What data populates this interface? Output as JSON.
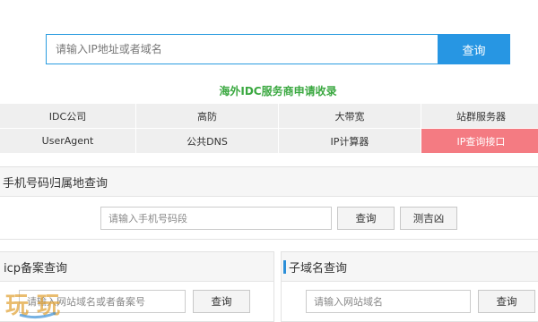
{
  "search": {
    "placeholder": "请输入IP地址或者域名",
    "button_label": "查询"
  },
  "apply_link": "海外IDC服务商申请收录",
  "nav": [
    {
      "label": "IDC公司",
      "active": false
    },
    {
      "label": "高防",
      "active": false
    },
    {
      "label": "大带宽",
      "active": false
    },
    {
      "label": "站群服务器",
      "active": false
    },
    {
      "label": "UserAgent",
      "active": false
    },
    {
      "label": "公共DNS",
      "active": false
    },
    {
      "label": "IP计算器",
      "active": false
    },
    {
      "label": "IP查询接口",
      "active": true
    }
  ],
  "mobile": {
    "title": "手机号码归属地查询",
    "placeholder": "请输入手机号码段",
    "query_label": "查询",
    "fortune_label": "测吉凶"
  },
  "icp": {
    "title": "icp备案查询",
    "placeholder": "请输入网站域名或者备案号",
    "query_label": "查询"
  },
  "subdomain": {
    "title": "子域名查询",
    "placeholder": "请输入网站域名",
    "query_label": "查询"
  },
  "watermark": {
    "text": "玩 玩"
  },
  "colors": {
    "primary_blue": "#2796e3",
    "green_link": "#3aa840",
    "active_tab": "#f47b82",
    "watermark": "#e0a030"
  }
}
